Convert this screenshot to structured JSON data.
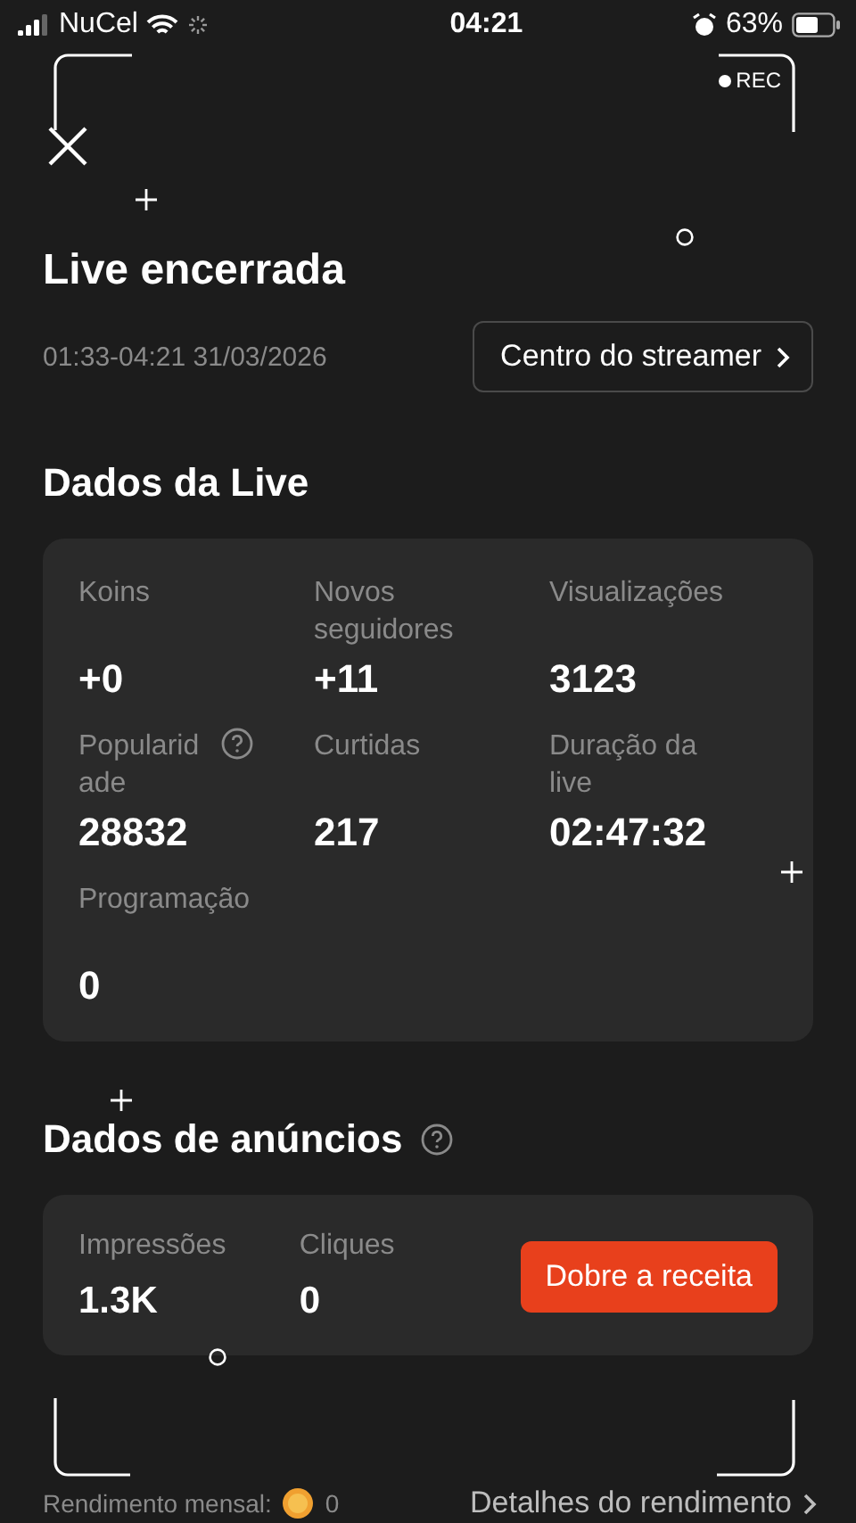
{
  "status_bar": {
    "carrier": "NuCel",
    "time": "04:21",
    "battery": "63%"
  },
  "recording": {
    "label": "REC"
  },
  "title": "Live encerrada",
  "time_range": "01:33-04:21 31/03/2026",
  "streamer_button": "Centro do streamer",
  "live_section": {
    "title": "Dados da Live",
    "stats": [
      {
        "label": "Koins",
        "value": "+0",
        "help": false
      },
      {
        "label": "Novos seguidores",
        "value": "+11",
        "help": false
      },
      {
        "label": "Visualizações",
        "value": "3123",
        "help": false
      },
      {
        "label": "Popularidade",
        "value": "28832",
        "help": true
      },
      {
        "label": "Curtidas",
        "value": "217",
        "help": false
      },
      {
        "label": "Duração da live",
        "value": "02:47:32",
        "help": false
      },
      {
        "label": "Programação",
        "value": "0",
        "help": false
      }
    ]
  },
  "ads_section": {
    "title": "Dados de anúncios",
    "help": true,
    "stats": [
      {
        "label": "Impressões",
        "value": "1.3K"
      },
      {
        "label": "Cliques",
        "value": "0"
      }
    ],
    "button": "Dobre a receita"
  },
  "footer": {
    "monthly_label": "Rendimento mensal:",
    "monthly_value": "0",
    "details_link": "Detalhes do rendimento"
  }
}
